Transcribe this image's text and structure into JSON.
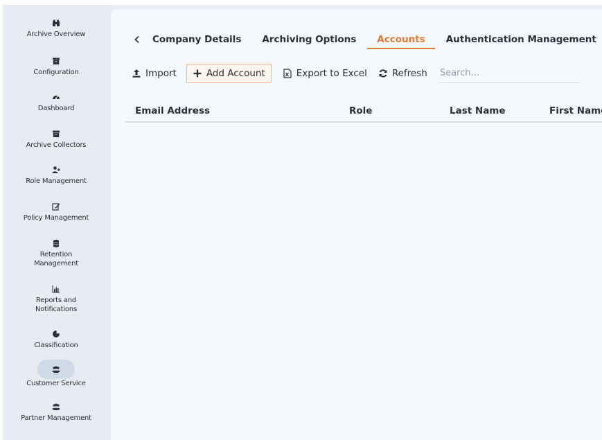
{
  "sidebar": {
    "items": [
      {
        "label": "Archive Overview",
        "icon": "binoculars-icon"
      },
      {
        "label": "Configuration",
        "icon": "archive-box-icon"
      },
      {
        "label": "Dashboard",
        "icon": "dashboard-gauge-icon"
      },
      {
        "label": "Archive Collectors",
        "icon": "archive-box-icon"
      },
      {
        "label": "Role Management",
        "icon": "user-plus-icon"
      },
      {
        "label": "Policy Management",
        "icon": "edit-icon"
      },
      {
        "label": "Retention Management",
        "icon": "database-icon"
      },
      {
        "label": "Reports and Notifications",
        "icon": "bar-chart-icon"
      },
      {
        "label": "Classification",
        "icon": "pie-chart-icon"
      },
      {
        "label": "Customer Service",
        "icon": "users-icon",
        "active": true
      },
      {
        "label": "Partner Management",
        "icon": "users-icon"
      }
    ]
  },
  "tabs": [
    {
      "label": "Company Details"
    },
    {
      "label": "Archiving Options"
    },
    {
      "label": "Accounts",
      "active": true
    },
    {
      "label": "Authentication Management"
    }
  ],
  "toolbar": {
    "import_label": "Import",
    "add_account_label": "Add Account",
    "export_label": "Export to Excel",
    "refresh_label": "Refresh",
    "search_placeholder": "Search..."
  },
  "table": {
    "columns": [
      "Email Address",
      "Role",
      "Last Name",
      "First Name"
    ]
  },
  "colors": {
    "accent": "#e07b35",
    "sidebar_bg": "#e6ecf1",
    "main_bg": "#f5f8fc",
    "active_pill": "#cfdbe7"
  }
}
